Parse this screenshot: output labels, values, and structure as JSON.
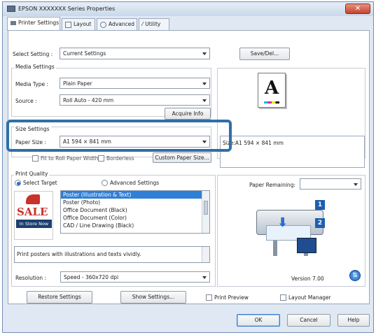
{
  "window": {
    "title": "EPSON XXXXXXX Series Properties",
    "close_glyph": "✕"
  },
  "tabs": [
    {
      "label": "Printer Settings"
    },
    {
      "label": "Layout"
    },
    {
      "label": "Advanced"
    },
    {
      "label": "Utility"
    }
  ],
  "select_setting": {
    "label": "Select Setting :",
    "value": "Current Settings",
    "save_del": "Save/Del..."
  },
  "media": {
    "title": "Media Settings",
    "media_type_label": "Media Type :",
    "media_type_value": "Plain Paper",
    "source_label": "Source :",
    "source_value": "Roll Auto - 420 mm",
    "acquire": "Acquire Info"
  },
  "size": {
    "title": "Size Settings",
    "paper_size_label": "Paper Size :",
    "paper_size_value": "A1 594 × 841 mm",
    "fit_label": "Fit to Roll Paper Width",
    "borderless_label": "Borderless",
    "custom_button": "Custom Paper Size..."
  },
  "preview": {
    "size_text": "Size:A1 594 × 841 mm",
    "letter": "A"
  },
  "print_quality": {
    "title": "Print Quality",
    "select_target": "Select Target",
    "advanced": "Advanced Settings",
    "items": [
      "Poster (Illustration & Text)",
      "Poster (Photo)",
      "Office Document (Black)",
      "Office Document (Color)",
      "CAD / Line Drawing (Black)"
    ],
    "selected_index": 0,
    "description": "Print posters with illustrations and texts vividly."
  },
  "sale_image": {
    "sale": "SALE",
    "in_store": "In Store Now"
  },
  "paper_remaining": {
    "label": "Paper Remaining:"
  },
  "printer_image": {
    "badge1": "1",
    "badge2": "2"
  },
  "version": {
    "text": "Version 7.00"
  },
  "resolution": {
    "label": "Resolution :",
    "value": "Speed - 360x720 dpi"
  },
  "bottom": {
    "restore": "Restore Settings",
    "show": "Show Settings...",
    "print_preview": "Print Preview",
    "layout_manager": "Layout Manager"
  },
  "footer": {
    "ok": "OK",
    "cancel": "Cancel",
    "help": "Help"
  },
  "colors": {
    "accent": "#2f6fa6",
    "selection": "#2f7fd6",
    "title_bg": "#c9d8ea"
  }
}
